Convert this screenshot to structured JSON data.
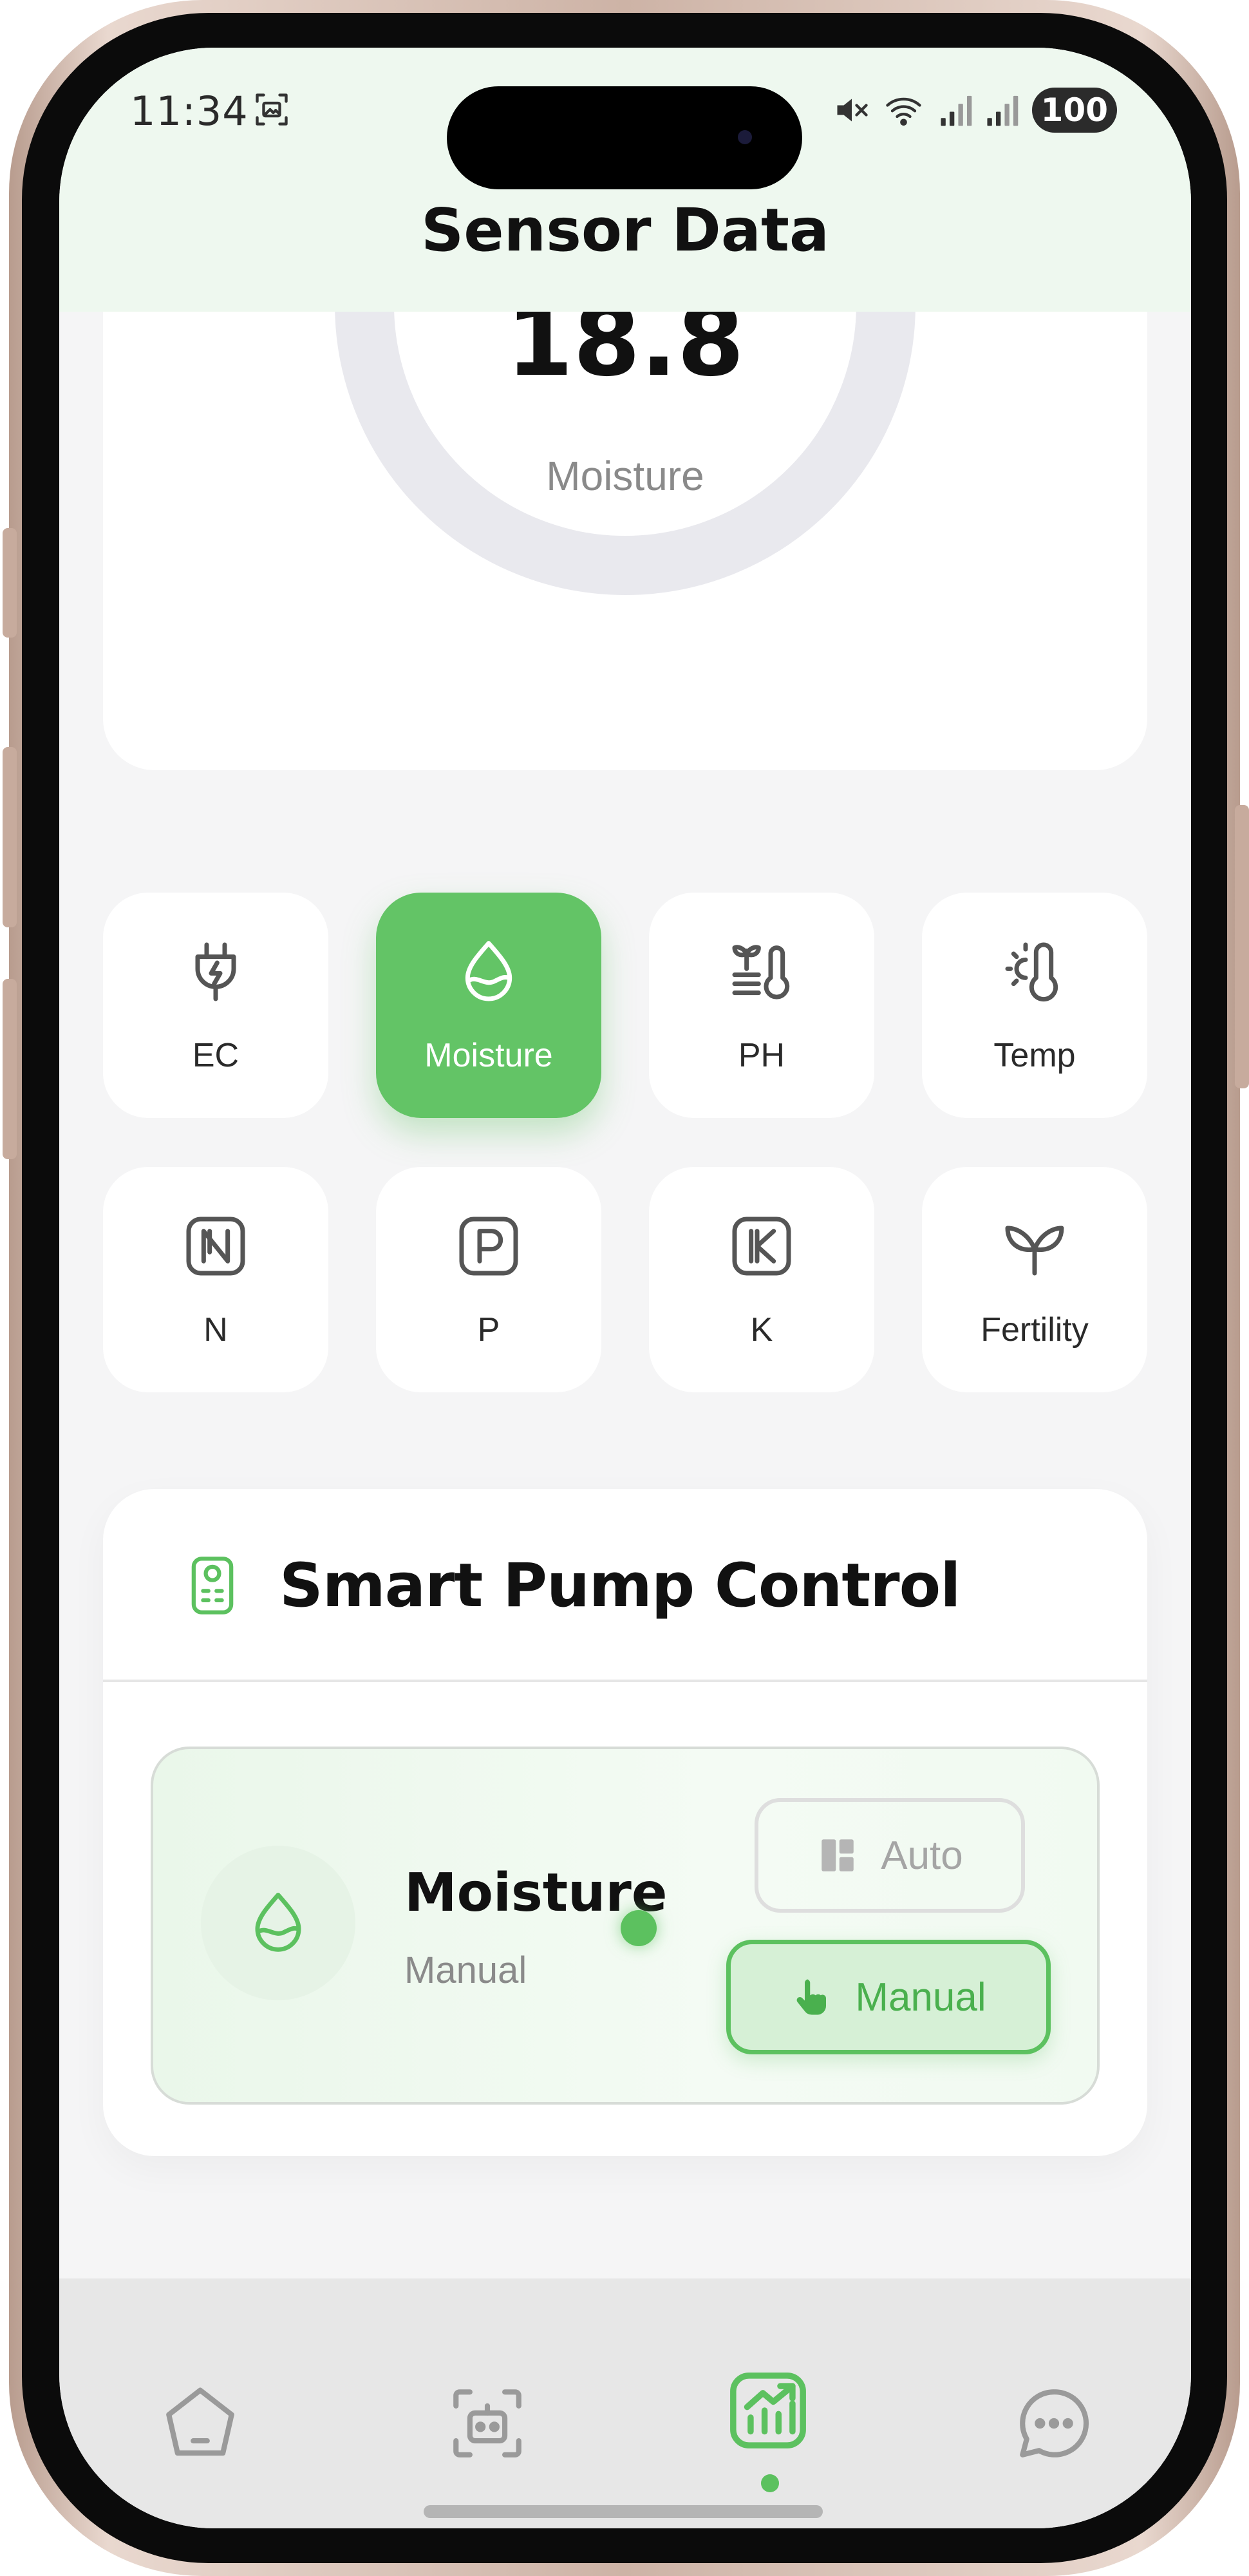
{
  "status_bar": {
    "time": "11:34",
    "battery": "100"
  },
  "header": {
    "title": "Sensor Data"
  },
  "gauge": {
    "value": "18.8",
    "label": "Moisture"
  },
  "sensors": [
    {
      "label": "EC",
      "icon": "plug-bolt-icon",
      "active": false
    },
    {
      "label": "Moisture",
      "icon": "water-drop-icon",
      "active": true
    },
    {
      "label": "PH",
      "icon": "ph-plant-icon",
      "active": false
    },
    {
      "label": "Temp",
      "icon": "thermometer-sun-icon",
      "active": false
    },
    {
      "label": "N",
      "icon": "letter-n-icon",
      "active": false
    },
    {
      "label": "P",
      "icon": "letter-p-icon",
      "active": false
    },
    {
      "label": "K",
      "icon": "letter-k-icon",
      "active": false
    },
    {
      "label": "Fertility",
      "icon": "sprout-icon",
      "active": false
    }
  ],
  "pump": {
    "title": "Smart Pump Control",
    "sensor_name": "Moisture",
    "mode": "Manual",
    "auto_label": "Auto",
    "manual_label": "Manual",
    "selected_mode": "Manual"
  },
  "nav": {
    "items": [
      "home-icon",
      "robot-scan-icon",
      "chart-icon",
      "chat-icon"
    ],
    "active": "chart-icon"
  },
  "colors": {
    "accent": "#63c466",
    "header_bg": "#eef8ef",
    "page_bg": "#f5f5f6",
    "text_dark": "#111111",
    "text_muted": "#8a8a8a"
  }
}
